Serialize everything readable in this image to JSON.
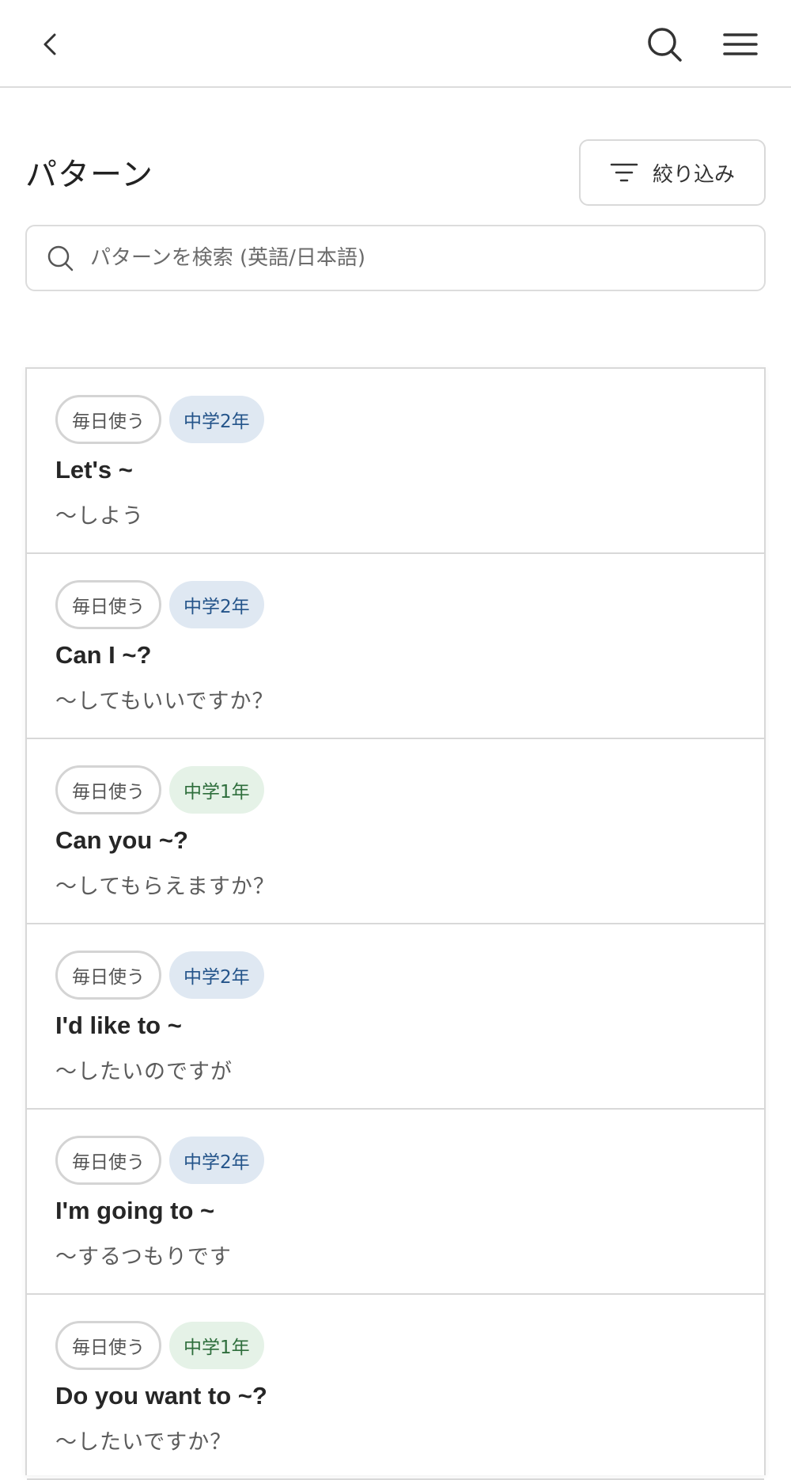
{
  "header": {
    "back_icon": "chevron-left-icon",
    "search_icon": "search-icon",
    "menu_icon": "hamburger-menu-icon"
  },
  "page": {
    "title": "パターン",
    "filter_label": "絞り込み",
    "filter_icon": "filter-icon"
  },
  "search": {
    "placeholder": "パターンを検索 (英語/日本語)",
    "value": ""
  },
  "colors": {
    "grade2_bg": "#dfe8f2",
    "grade2_text": "#24548a",
    "grade1_bg": "#e5f2e7",
    "grade1_text": "#2e6e3c"
  },
  "patterns": [
    {
      "daily_tag": "毎日使う",
      "grade": "中学2年",
      "english": "Let's ~",
      "japanese": "〜しよう"
    },
    {
      "daily_tag": "毎日使う",
      "grade": "中学2年",
      "english": "Can I ~?",
      "japanese": "〜してもいいですか？"
    },
    {
      "daily_tag": "毎日使う",
      "grade": "中学1年",
      "english": "Can you ~?",
      "japanese": "〜してもらえますか？"
    },
    {
      "daily_tag": "毎日使う",
      "grade": "中学2年",
      "english": "I'd like to ~",
      "japanese": "〜したいのですが"
    },
    {
      "daily_tag": "毎日使う",
      "grade": "中学2年",
      "english": "I'm going to ~",
      "japanese": "〜するつもりです"
    },
    {
      "daily_tag": "毎日使う",
      "grade": "中学1年",
      "english": "Do you want to ~?",
      "japanese": "〜したいですか？"
    }
  ]
}
